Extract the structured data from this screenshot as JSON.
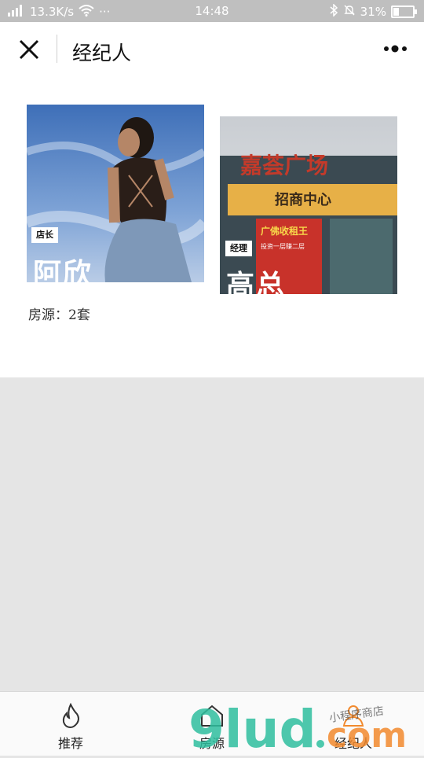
{
  "status_bar": {
    "signal": "4G",
    "speed": "13.3K/s",
    "dots": "···",
    "time": "14:48",
    "battery_percent": "31%",
    "battery_level": 0.31
  },
  "nav": {
    "title": "经纪人"
  },
  "agents": [
    {
      "role": "店长",
      "name": "阿欣"
    },
    {
      "role": "经理",
      "name": "高总"
    }
  ],
  "listing": {
    "count_text": "房源：2套"
  },
  "tabs": [
    {
      "label": "推荐",
      "icon": "flame-icon"
    },
    {
      "label": "房源",
      "icon": "house-icon"
    },
    {
      "label": "经纪人",
      "icon": "person-icon"
    }
  ],
  "photo2_signs": {
    "top_sign": "嘉荟广场",
    "banner": "招商中心",
    "poster": "广佛收租王",
    "poster_sub": "投资一层赚二层"
  },
  "watermark": {
    "text": "9lud.com",
    "subtext": "小程序商店"
  },
  "colors": {
    "status_bar_bg": "#bfbfbf",
    "page_bg": "#e5e5e5",
    "card_bg": "#ffffff",
    "watermark_teal": "#2fbf9f",
    "watermark_orange": "#f28a2e"
  }
}
